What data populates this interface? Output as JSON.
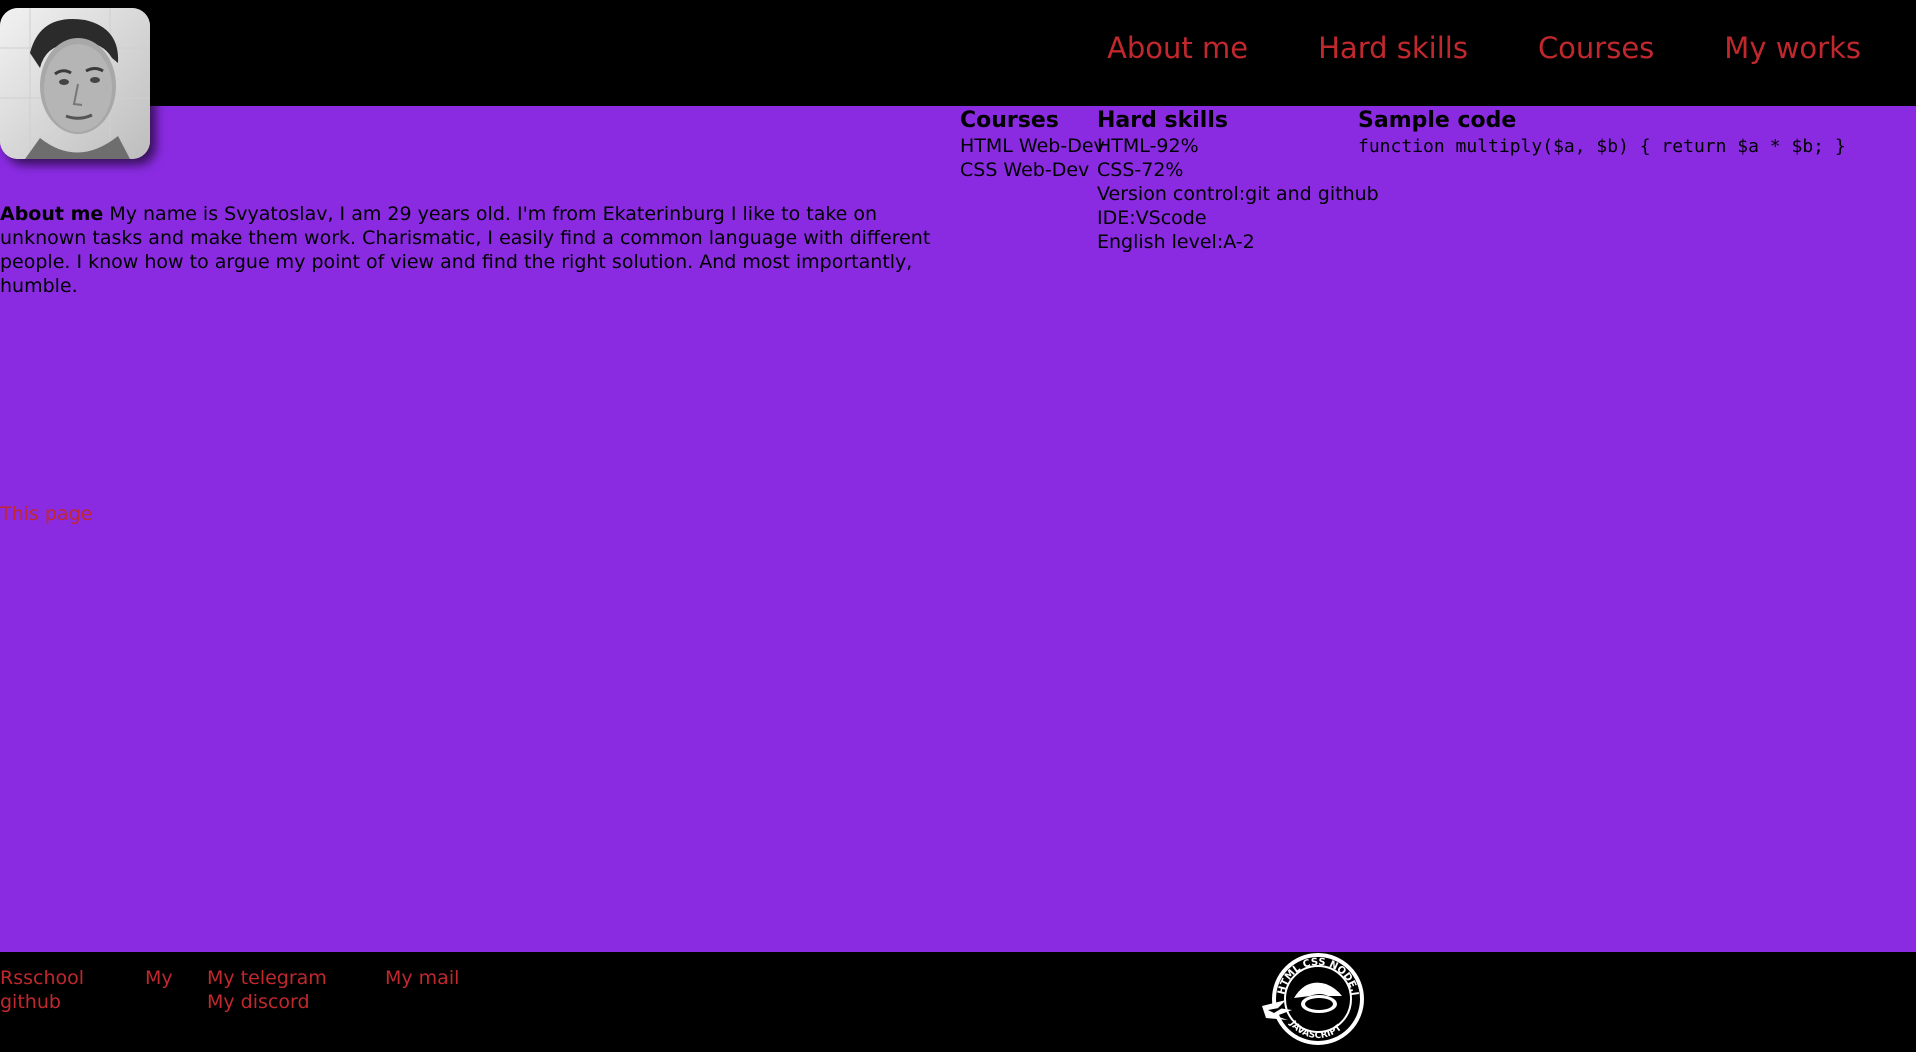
{
  "nav": {
    "items": [
      "About me",
      "Hard skills",
      "Courses",
      "My works"
    ]
  },
  "about": {
    "heading": "About me",
    "text": "My name is Svyatoslav, I am 29 years old. I'm from Ekaterinburg I like to take on unknown tasks and make them work. Charismatic, I easily find a common language with different people. I know how to argue my point of view and find the right solution. And most importantly, humble."
  },
  "courses": {
    "heading": "Courses",
    "items": [
      "HTML Web-Dev",
      "CSS Web-Dev"
    ]
  },
  "hard_skills": {
    "heading": "Hard skills",
    "items": [
      "HTML-92%",
      "CSS-72%",
      "Version control:git and github",
      "IDE:VScode",
      "English level:A-2"
    ]
  },
  "sample_code": {
    "heading": "Sample code",
    "code": "function multiply($a, $b) { return $a * $b; }"
  },
  "this_page": "This page",
  "footer": {
    "rsschool": "Rsschool github",
    "my": "My",
    "telegram": "My telegram",
    "discord": "My discord",
    "mail": "My mail",
    "badge_text_top": "HTML CSS NODE.JS",
    "badge_text_bottom": "JAVASCRIPT"
  },
  "colors": {
    "background": "#8a2be2",
    "bars": "#000000",
    "link": "#c0282d"
  },
  "icons": {
    "avatar": "profile-photo",
    "badge": "rolling-scopes-school-badge"
  }
}
